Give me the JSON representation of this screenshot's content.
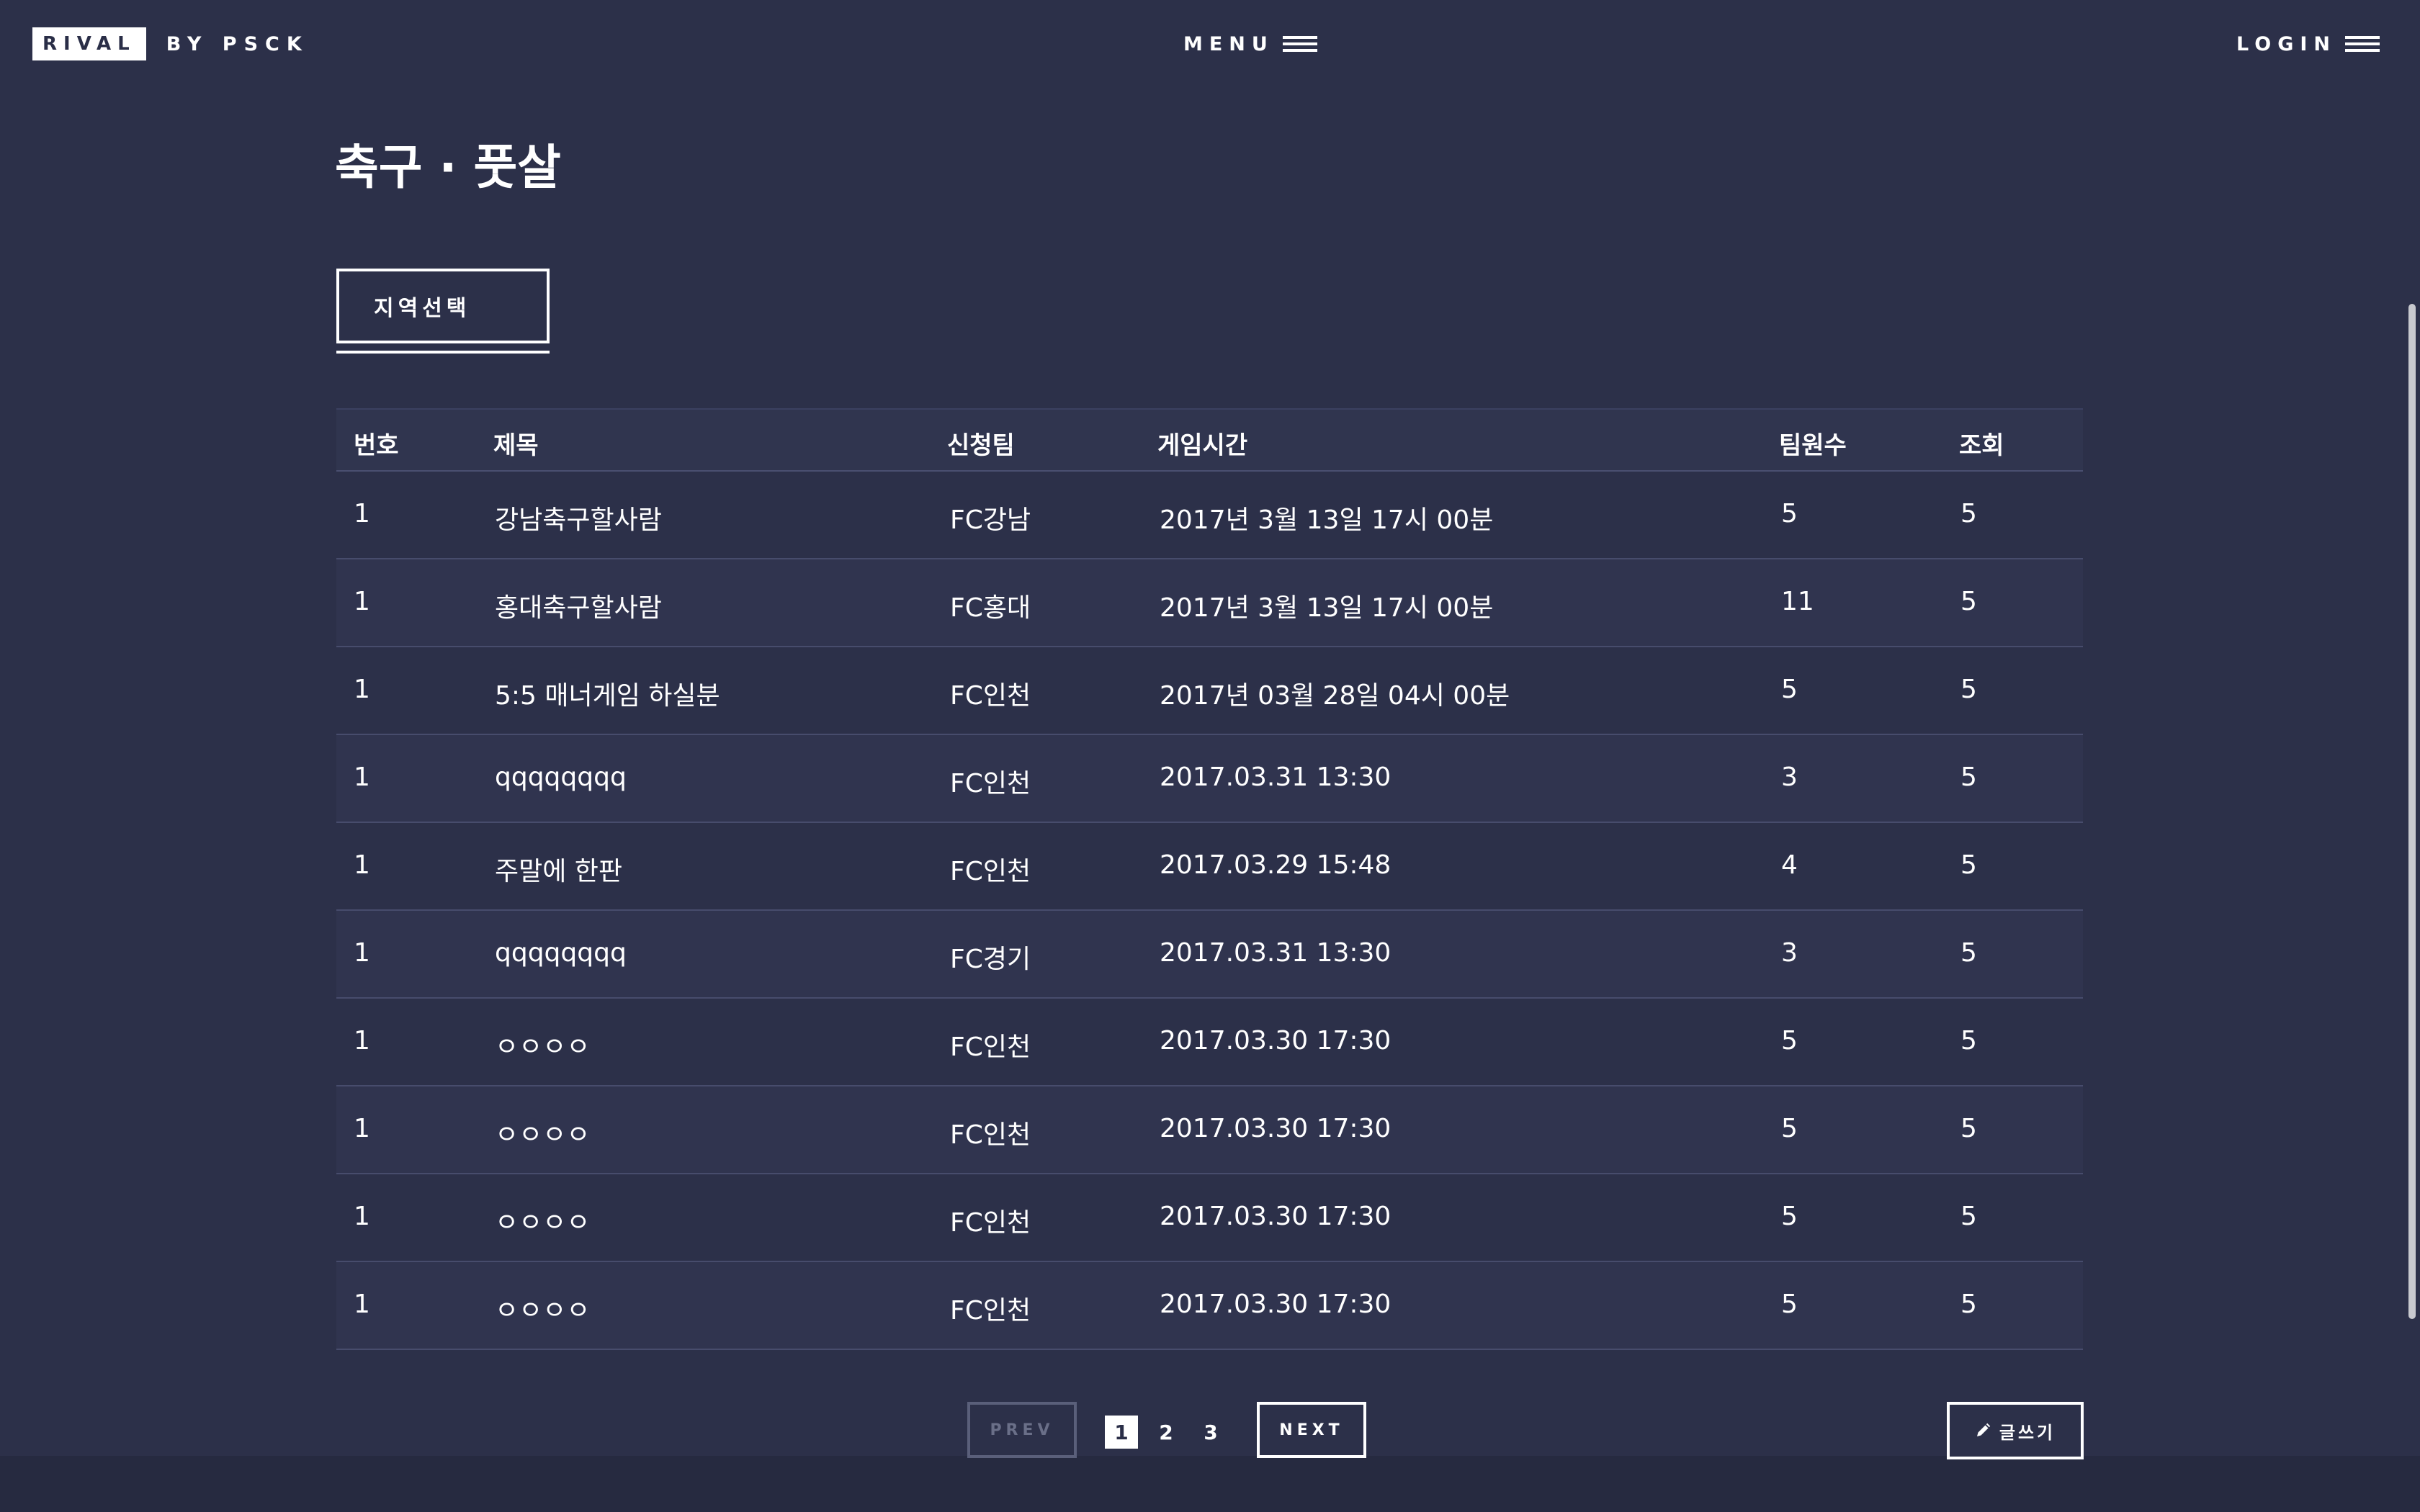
{
  "header": {
    "logo_box": "RIVAL",
    "logo_by": "BY PSCK",
    "menu_label": "MENU",
    "login_label": "LOGIN"
  },
  "page_title": "축구 · 풋살",
  "region_button_label": "지역선택",
  "table": {
    "headers": [
      "번호",
      "제목",
      "신청팀",
      "게임시간",
      "팀원수",
      "조회"
    ],
    "rows": [
      {
        "no": "1",
        "title": "강남축구할사람",
        "team": "FC강남",
        "time": "2017년 3월 13일 17시 00분",
        "count": "5",
        "views": "5"
      },
      {
        "no": "1",
        "title": "홍대축구할사람",
        "team": "FC홍대",
        "time": "2017년 3월 13일 17시 00분",
        "count": "11",
        "views": "5"
      },
      {
        "no": "1",
        "title": "5:5 매너게임 하실분",
        "team": "FC인천",
        "time": "2017년 03월 28일 04시 00분",
        "count": "5",
        "views": "5"
      },
      {
        "no": "1",
        "title": "qqqqqqqq",
        "team": "FC인천",
        "time": "2017.03.31 13:30",
        "count": "3",
        "views": "5"
      },
      {
        "no": "1",
        "title": "주말에 한판",
        "team": "FC인천",
        "time": "2017.03.29 15:48",
        "count": "4",
        "views": "5"
      },
      {
        "no": "1",
        "title": "qqqqqqqq",
        "team": "FC경기",
        "time": "2017.03.31 13:30",
        "count": "3",
        "views": "5"
      },
      {
        "no": "1",
        "title": "ㅇㅇㅇㅇ",
        "team": "FC인천",
        "time": "2017.03.30 17:30",
        "count": "5",
        "views": "5"
      },
      {
        "no": "1",
        "title": "ㅇㅇㅇㅇ",
        "team": "FC인천",
        "time": "2017.03.30 17:30",
        "count": "5",
        "views": "5"
      },
      {
        "no": "1",
        "title": "ㅇㅇㅇㅇ",
        "team": "FC인천",
        "time": "2017.03.30 17:30",
        "count": "5",
        "views": "5"
      },
      {
        "no": "1",
        "title": "ㅇㅇㅇㅇ",
        "team": "FC인천",
        "time": "2017.03.30 17:30",
        "count": "5",
        "views": "5"
      }
    ]
  },
  "pagination": {
    "prev_label": "PREV",
    "pages": [
      "1",
      "2",
      "3"
    ],
    "active_page": "1",
    "next_label": "NEXT"
  },
  "write_button_label": "글쓰기",
  "icons": {
    "menu": "hamburger-menu-icon",
    "login": "hamburger-menu-icon",
    "write": "pencil-icon"
  },
  "colors": {
    "background": "#2c3049",
    "row_alt": "#30344f",
    "text": "#ffffff",
    "disabled": "#6a6f88"
  }
}
